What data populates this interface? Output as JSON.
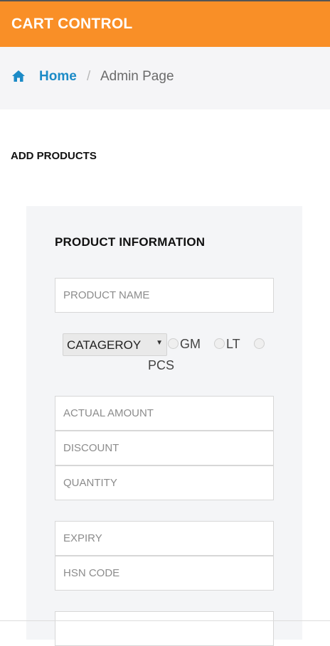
{
  "header": {
    "brand": "CART CONTROL"
  },
  "breadcrumb": {
    "home": "Home",
    "separator": "/",
    "current": "Admin Page"
  },
  "section": {
    "title": "ADD PRODUCTS"
  },
  "panel": {
    "title": "PRODUCT INFORMATION",
    "fields": {
      "product_name": "PRODUCT NAME",
      "actual_amount": "ACTUAL AMOUNT",
      "discount": "DISCOUNT",
      "quantity": "QUANTITY",
      "expiry": "EXPIRY",
      "hsn_code": "HSN CODE"
    },
    "category": {
      "selected": "CATAGEROY"
    },
    "units": [
      "GM",
      "LT",
      "PCS"
    ]
  },
  "colors": {
    "brand_bar": "#f98f27",
    "link": "#1c8bc7"
  }
}
